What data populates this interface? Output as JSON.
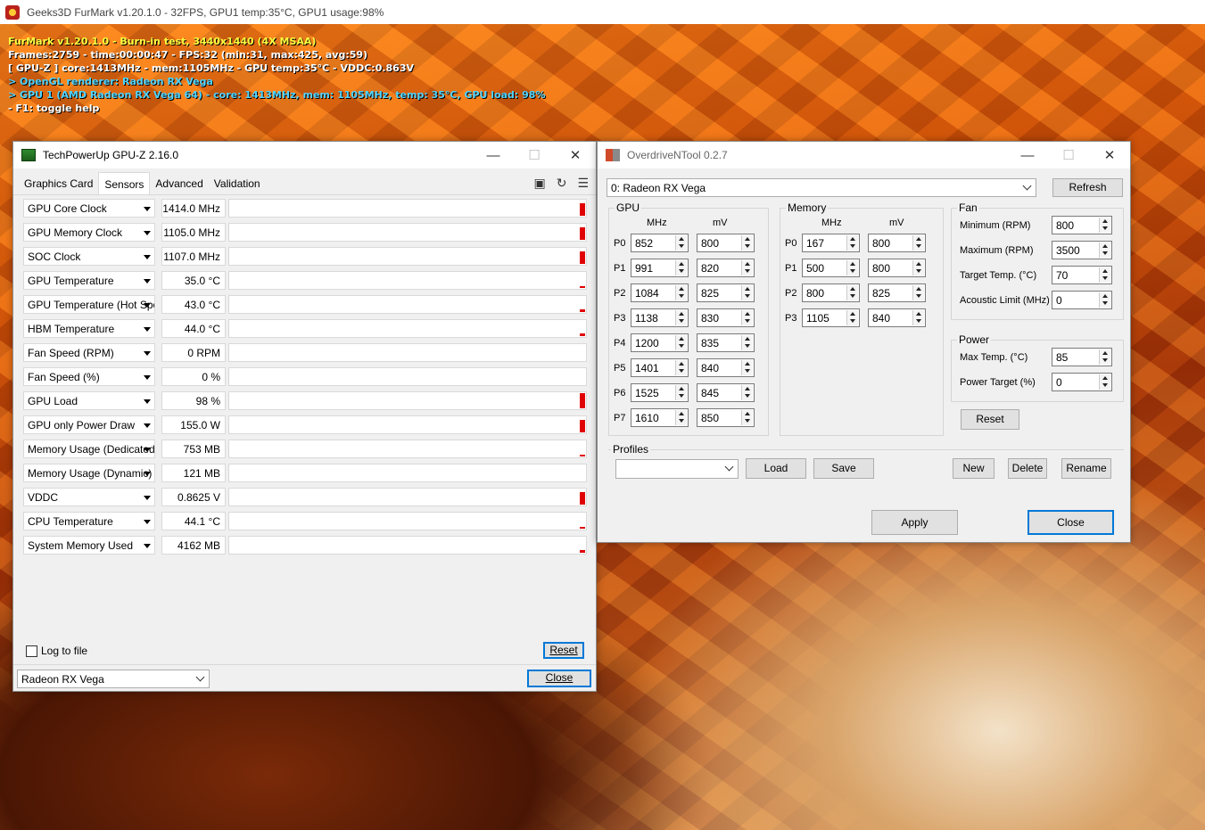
{
  "furmark": {
    "title": "Geeks3D FurMark v1.20.1.0 - 32FPS, GPU1 temp:35°C, GPU1 usage:98%",
    "overlay": [
      "FurMark v1.20.1.0 - Burn-in test, 3440x1440 (4X MSAA)",
      "Frames:2759 - time:00:00:47 - FPS:32 (min:31, max:425, avg:59)",
      "[ GPU-Z ] core:1413MHz - mem:1105MHz - GPU temp:35°C - VDDC:0.863V",
      "> OpenGL renderer: Radeon RX Vega",
      "> GPU 1 (AMD Radeon RX Vega 64) - core: 1413MHz, mem: 1105MHz, temp: 35°C, GPU load: 98%",
      "- F1: toggle help"
    ]
  },
  "gpuz": {
    "title": "TechPowerUp GPU-Z 2.16.0",
    "tabs": [
      "Graphics Card",
      "Sensors",
      "Advanced",
      "Validation"
    ],
    "sensors": [
      {
        "name": "GPU Core Clock",
        "value": "1414.0 MHz",
        "level": 0.75
      },
      {
        "name": "GPU Memory Clock",
        "value": "1105.0 MHz",
        "level": 0.75
      },
      {
        "name": "SOC Clock",
        "value": "1107.0 MHz",
        "level": 0.75
      },
      {
        "name": "GPU Temperature",
        "value": "35.0 °C",
        "level": 0.1
      },
      {
        "name": "GPU Temperature (Hot Spot)",
        "value": "43.0 °C",
        "level": 0.15
      },
      {
        "name": "HBM Temperature",
        "value": "44.0 °C",
        "level": 0.15
      },
      {
        "name": "Fan Speed (RPM)",
        "value": "0 RPM",
        "level": 0
      },
      {
        "name": "Fan Speed (%)",
        "value": "0 %",
        "level": 0
      },
      {
        "name": "GPU Load",
        "value": "98 %",
        "level": 0.9
      },
      {
        "name": "GPU only Power Draw",
        "value": "155.0 W",
        "level": 0.75
      },
      {
        "name": "Memory Usage (Dedicated)",
        "value": "753 MB",
        "level": 0.06
      },
      {
        "name": "Memory Usage (Dynamic)",
        "value": "121 MB",
        "level": 0
      },
      {
        "name": "VDDC",
        "value": "0.8625 V",
        "level": 0.75
      },
      {
        "name": "CPU Temperature",
        "value": "44.1 °C",
        "level": 0.08
      },
      {
        "name": "System Memory Used",
        "value": "4162 MB",
        "level": 0.15
      }
    ],
    "log_to_file": "Log to file",
    "reset": "Reset",
    "close": "Close",
    "device": "Radeon RX Vega"
  },
  "odnt": {
    "title": "OverdriveNTool 0.2.7",
    "gpu_select": "0: Radeon RX Vega",
    "refresh": "Refresh",
    "gpu_group": "GPU",
    "mem_group": "Memory",
    "fan_group": "Fan",
    "power_group": "Power",
    "profiles_group": "Profiles",
    "mhz": "MHz",
    "mv": "mV",
    "gpu_states": [
      {
        "p": "P0",
        "mhz": "852",
        "mv": "800"
      },
      {
        "p": "P1",
        "mhz": "991",
        "mv": "820"
      },
      {
        "p": "P2",
        "mhz": "1084",
        "mv": "825"
      },
      {
        "p": "P3",
        "mhz": "1138",
        "mv": "830"
      },
      {
        "p": "P4",
        "mhz": "1200",
        "mv": "835"
      },
      {
        "p": "P5",
        "mhz": "1401",
        "mv": "840"
      },
      {
        "p": "P6",
        "mhz": "1525",
        "mv": "845"
      },
      {
        "p": "P7",
        "mhz": "1610",
        "mv": "850"
      }
    ],
    "mem_states": [
      {
        "p": "P0",
        "mhz": "167",
        "mv": "800"
      },
      {
        "p": "P1",
        "mhz": "500",
        "mv": "800"
      },
      {
        "p": "P2",
        "mhz": "800",
        "mv": "825"
      },
      {
        "p": "P3",
        "mhz": "1105",
        "mv": "840"
      }
    ],
    "fan": [
      {
        "label": "Minimum (RPM)",
        "value": "800"
      },
      {
        "label": "Maximum (RPM)",
        "value": "3500"
      },
      {
        "label": "Target Temp. (°C)",
        "value": "70"
      },
      {
        "label": "Acoustic Limit (MHz)",
        "value": "0"
      }
    ],
    "power": [
      {
        "label": "Max Temp. (°C)",
        "value": "85"
      },
      {
        "label": "Power Target (%)",
        "value": "0"
      }
    ],
    "reset": "Reset",
    "load": "Load",
    "save": "Save",
    "new": "New",
    "delete": "Delete",
    "rename": "Rename",
    "apply": "Apply",
    "close": "Close"
  }
}
